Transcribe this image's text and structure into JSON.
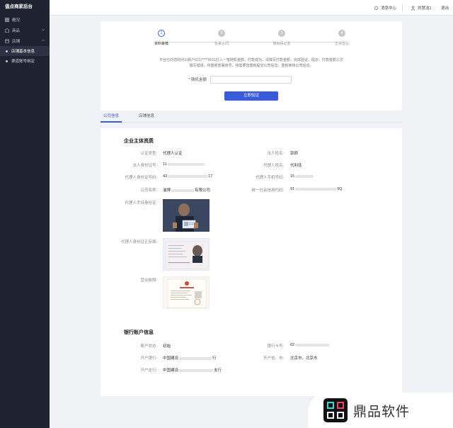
{
  "sidebar": {
    "brand": "值点商家后台",
    "items": [
      {
        "label": "概况",
        "icon": "grid-icon"
      },
      {
        "label": "商品",
        "icon": "box-icon"
      },
      {
        "label": "店铺",
        "icon": "store-icon"
      }
    ],
    "sub_items": [
      {
        "label": "店铺基本信息",
        "active": true
      },
      {
        "label": "渠道账号绑定",
        "active": false
      }
    ]
  },
  "topbar": {
    "messages": "消息中心",
    "user": "刘慧洁1",
    "logout": "退出"
  },
  "steps": [
    {
      "num": "1",
      "label": "资料审核",
      "state": "active"
    },
    {
      "num": "2",
      "label": "签署合同",
      "state": "pending"
    },
    {
      "num": "3",
      "label": "缴纳保证金",
      "state": "pending"
    },
    {
      "num": "4",
      "label": "正常营业",
      "state": "pending"
    }
  ],
  "verify": {
    "notice_line1": "平台已向您的对公账户6217****8011打入一笔随机金额，打款成功，请填写打款金额，完成验证。提示：打款金额三次",
    "notice_line2": "填写错误，将重新签署账号，持需要您重新提交公司信息，重新审核公司信息。",
    "amount_label": "随机金额",
    "amount_placeholder": "",
    "button": "立即验证"
  },
  "tabs": [
    {
      "label": "公司信息",
      "active": true
    },
    {
      "label": "店铺信息",
      "active": false
    }
  ],
  "company": {
    "title": "企业主体资质",
    "auth_type_label": "认证类型:",
    "auth_type": "代理人认证",
    "legal_name_label": "法人姓名:",
    "legal_name": "郭颜",
    "legal_id_label": "法人身份证号:",
    "legal_id": "11",
    "agent_name_label": "代理人姓名:",
    "agent_name": "代利佳",
    "agent_id_label": "代理人身份证号码:",
    "agent_id_prefix": "43",
    "agent_id_suffix": "17",
    "agent_phone_label": "代理人手机号码:",
    "agent_phone": "15",
    "company_name_label": "公司名称:",
    "company_name_prefix": "淄博",
    "company_name_suffix": "有限公司",
    "credit_code_label": "统一社会信用代码:",
    "credit_code_prefix": "91",
    "credit_code_suffix": "9Q",
    "agent_photo_label": "代理人手持身份证:",
    "agent_card_label": "代理人身份证正反面:",
    "license_label": "营业执照:"
  },
  "bank": {
    "title": "银行账户信息",
    "status_label": "账户状态:",
    "status": "初始",
    "card_no_label": "银行卡号:",
    "card_no": "62",
    "bank_label": "开户银行:",
    "bank_prefix": "中国建设",
    "bank_suffix": "行",
    "region_label": "开户省、市:",
    "region": "北京市、北京市",
    "branch_label": "开户支行:",
    "branch_prefix": "中国建设",
    "branch_suffix": "支行"
  },
  "watermark": {
    "text": "鼎品软件"
  },
  "colors": {
    "primary": "#3a5bd9",
    "sidebar": "#1f2230",
    "background": "#f0f2f5"
  }
}
